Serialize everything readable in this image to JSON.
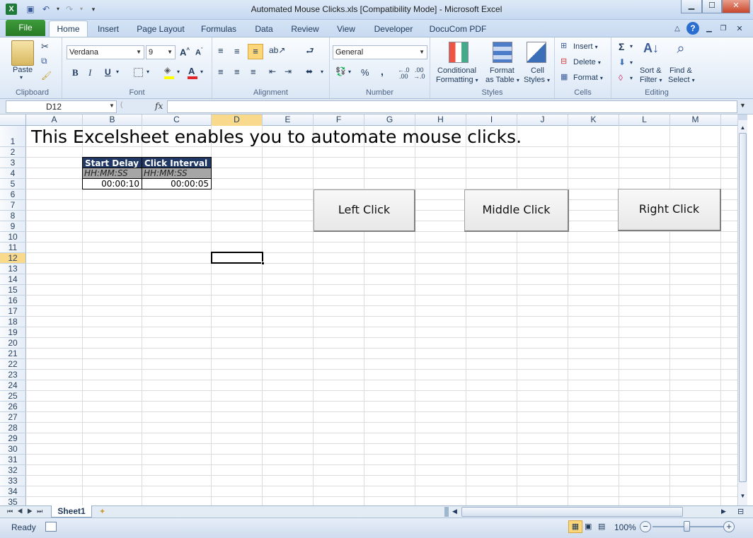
{
  "window": {
    "title": "Automated Mouse Clicks.xls  [Compatibility Mode]  -  Microsoft Excel"
  },
  "tabs": {
    "file": "File",
    "home": "Home",
    "insert": "Insert",
    "page_layout": "Page Layout",
    "formulas": "Formulas",
    "data": "Data",
    "review": "Review",
    "view": "View",
    "developer": "Developer",
    "docucom": "DocuCom PDF"
  },
  "ribbon": {
    "clipboard": {
      "label": "Clipboard",
      "paste": "Paste"
    },
    "font": {
      "label": "Font",
      "name": "Verdana",
      "size": "9",
      "bold": "B",
      "italic": "I",
      "underline": "U"
    },
    "alignment": {
      "label": "Alignment"
    },
    "number": {
      "label": "Number",
      "format": "General",
      "percent": "%",
      "comma": ","
    },
    "styles": {
      "label": "Styles",
      "conditional_1": "Conditional",
      "conditional_2": "Formatting",
      "table_1": "Format",
      "table_2": "as Table",
      "cell_1": "Cell",
      "cell_2": "Styles"
    },
    "cells": {
      "label": "Cells",
      "insert": "Insert",
      "delete": "Delete",
      "format": "Format"
    },
    "editing": {
      "label": "Editing",
      "sigma": "Σ",
      "sort_1": "Sort &",
      "sort_2": "Filter",
      "find_1": "Find &",
      "find_2": "Select"
    }
  },
  "formula_bar": {
    "name_box": "D12",
    "fx": "fx",
    "value": ""
  },
  "columns": [
    "A",
    "B",
    "C",
    "D",
    "E",
    "F",
    "G",
    "H",
    "I",
    "J",
    "K",
    "L",
    "M"
  ],
  "rows": [
    "1",
    "2",
    "3",
    "4",
    "5",
    "6",
    "7",
    "8",
    "9",
    "10",
    "11",
    "12",
    "13",
    "14",
    "15",
    "16",
    "17",
    "18",
    "19",
    "20",
    "21",
    "22",
    "23",
    "24",
    "25",
    "26",
    "27",
    "28",
    "29",
    "30",
    "31",
    "32",
    "33",
    "34",
    "35"
  ],
  "sheet": {
    "title": "This Excelsheet enables you to automate mouse clicks.",
    "header_start_delay": "Start Delay",
    "header_click_interval": "Click Interval",
    "format_start": "HH:MM:SS",
    "format_interval": "HH:MM:SS",
    "value_start": "00:00:10",
    "value_interval": "00:00:05",
    "btn_left": "Left Click",
    "btn_middle": "Middle Click",
    "btn_right": "Right Click"
  },
  "sheet_tabs": {
    "active": "Sheet1"
  },
  "status": {
    "ready": "Ready",
    "zoom": "100%"
  },
  "colors": {
    "header_fill": "#1f3864",
    "format_fill": "#a6a6a6",
    "selected_col": "#f9d98b"
  }
}
